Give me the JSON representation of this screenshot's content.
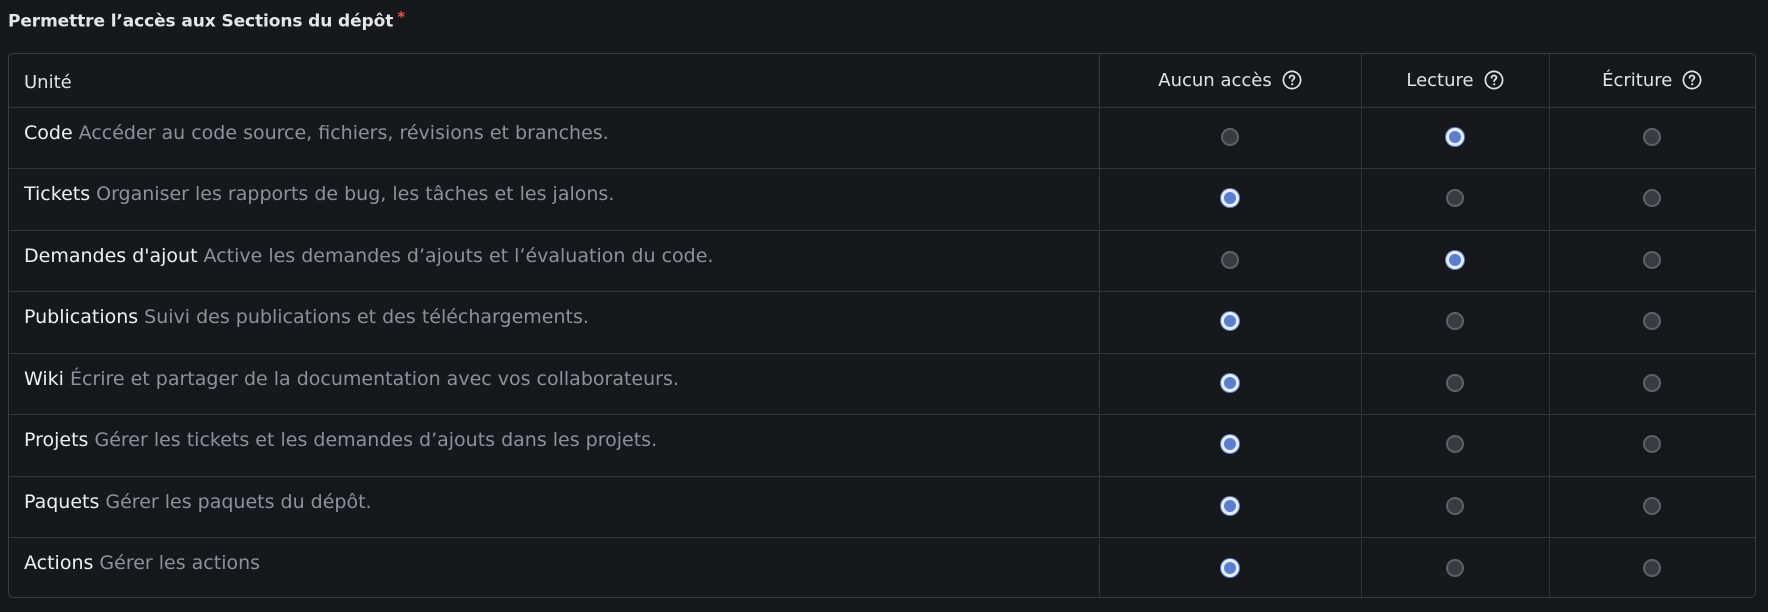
{
  "section": {
    "title": "Permettre l’accès aux Sections du dépôt",
    "required_mark": "*"
  },
  "columns": {
    "unit": "Unité",
    "none": "Aucun accès",
    "read": "Lecture",
    "write": "Écriture",
    "help_icon": "question-circle-icon"
  },
  "rows": [
    {
      "name": "Code",
      "desc": "Accéder au code source, fichiers, révisions et branches.",
      "selected": "read"
    },
    {
      "name": "Tickets",
      "desc": "Organiser les rapports de bug, les tâches et les jalons.",
      "selected": "none"
    },
    {
      "name": "Demandes d'ajout",
      "desc": "Active les demandes d’ajouts et l’évaluation du code.",
      "selected": "read"
    },
    {
      "name": "Publications",
      "desc": "Suivi des publications et des téléchargements.",
      "selected": "none"
    },
    {
      "name": "Wiki",
      "desc": "Écrire et partager de la documentation avec vos collaborateurs.",
      "selected": "none"
    },
    {
      "name": "Projets",
      "desc": "Gérer les tickets et les demandes d’ajouts dans les projets.",
      "selected": "none"
    },
    {
      "name": "Paquets",
      "desc": "Gérer les paquets du dépôt.",
      "selected": "none"
    },
    {
      "name": "Actions",
      "desc": "Gérer les actions",
      "selected": "none"
    }
  ],
  "colors": {
    "background": "#17181c",
    "border": "#33353c",
    "radio_checked": "#5a7fcf",
    "required": "#e5534b"
  }
}
